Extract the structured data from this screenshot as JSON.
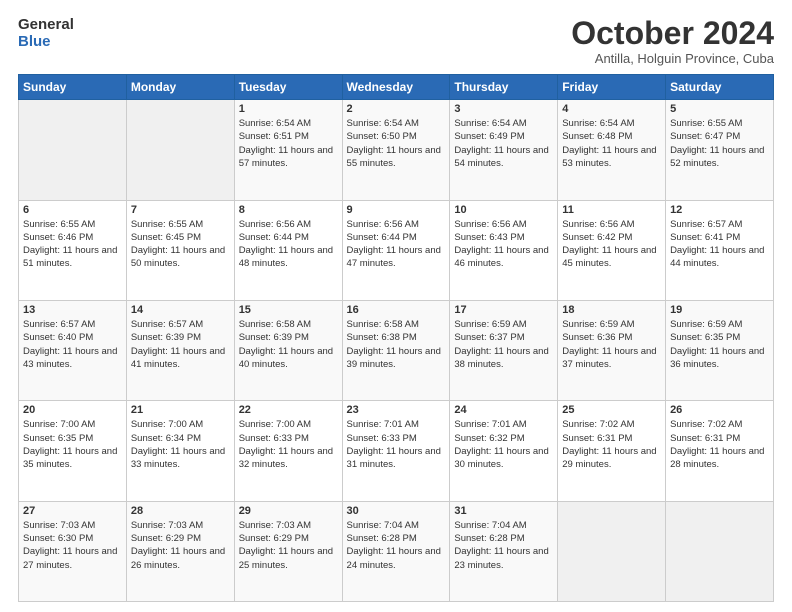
{
  "logo": {
    "line1": "General",
    "line2": "Blue"
  },
  "header": {
    "title": "October 2024",
    "subtitle": "Antilla, Holguin Province, Cuba"
  },
  "weekdays": [
    "Sunday",
    "Monday",
    "Tuesday",
    "Wednesday",
    "Thursday",
    "Friday",
    "Saturday"
  ],
  "weeks": [
    [
      {
        "day": "",
        "empty": true
      },
      {
        "day": "",
        "empty": true
      },
      {
        "day": "1",
        "sunrise": "6:54 AM",
        "sunset": "6:51 PM",
        "daylight": "11 hours and 57 minutes."
      },
      {
        "day": "2",
        "sunrise": "6:54 AM",
        "sunset": "6:50 PM",
        "daylight": "11 hours and 55 minutes."
      },
      {
        "day": "3",
        "sunrise": "6:54 AM",
        "sunset": "6:49 PM",
        "daylight": "11 hours and 54 minutes."
      },
      {
        "day": "4",
        "sunrise": "6:54 AM",
        "sunset": "6:48 PM",
        "daylight": "11 hours and 53 minutes."
      },
      {
        "day": "5",
        "sunrise": "6:55 AM",
        "sunset": "6:47 PM",
        "daylight": "11 hours and 52 minutes."
      }
    ],
    [
      {
        "day": "6",
        "sunrise": "6:55 AM",
        "sunset": "6:46 PM",
        "daylight": "11 hours and 51 minutes."
      },
      {
        "day": "7",
        "sunrise": "6:55 AM",
        "sunset": "6:45 PM",
        "daylight": "11 hours and 50 minutes."
      },
      {
        "day": "8",
        "sunrise": "6:56 AM",
        "sunset": "6:44 PM",
        "daylight": "11 hours and 48 minutes."
      },
      {
        "day": "9",
        "sunrise": "6:56 AM",
        "sunset": "6:44 PM",
        "daylight": "11 hours and 47 minutes."
      },
      {
        "day": "10",
        "sunrise": "6:56 AM",
        "sunset": "6:43 PM",
        "daylight": "11 hours and 46 minutes."
      },
      {
        "day": "11",
        "sunrise": "6:56 AM",
        "sunset": "6:42 PM",
        "daylight": "11 hours and 45 minutes."
      },
      {
        "day": "12",
        "sunrise": "6:57 AM",
        "sunset": "6:41 PM",
        "daylight": "11 hours and 44 minutes."
      }
    ],
    [
      {
        "day": "13",
        "sunrise": "6:57 AM",
        "sunset": "6:40 PM",
        "daylight": "11 hours and 43 minutes."
      },
      {
        "day": "14",
        "sunrise": "6:57 AM",
        "sunset": "6:39 PM",
        "daylight": "11 hours and 41 minutes."
      },
      {
        "day": "15",
        "sunrise": "6:58 AM",
        "sunset": "6:39 PM",
        "daylight": "11 hours and 40 minutes."
      },
      {
        "day": "16",
        "sunrise": "6:58 AM",
        "sunset": "6:38 PM",
        "daylight": "11 hours and 39 minutes."
      },
      {
        "day": "17",
        "sunrise": "6:59 AM",
        "sunset": "6:37 PM",
        "daylight": "11 hours and 38 minutes."
      },
      {
        "day": "18",
        "sunrise": "6:59 AM",
        "sunset": "6:36 PM",
        "daylight": "11 hours and 37 minutes."
      },
      {
        "day": "19",
        "sunrise": "6:59 AM",
        "sunset": "6:35 PM",
        "daylight": "11 hours and 36 minutes."
      }
    ],
    [
      {
        "day": "20",
        "sunrise": "7:00 AM",
        "sunset": "6:35 PM",
        "daylight": "11 hours and 35 minutes."
      },
      {
        "day": "21",
        "sunrise": "7:00 AM",
        "sunset": "6:34 PM",
        "daylight": "11 hours and 33 minutes."
      },
      {
        "day": "22",
        "sunrise": "7:00 AM",
        "sunset": "6:33 PM",
        "daylight": "11 hours and 32 minutes."
      },
      {
        "day": "23",
        "sunrise": "7:01 AM",
        "sunset": "6:33 PM",
        "daylight": "11 hours and 31 minutes."
      },
      {
        "day": "24",
        "sunrise": "7:01 AM",
        "sunset": "6:32 PM",
        "daylight": "11 hours and 30 minutes."
      },
      {
        "day": "25",
        "sunrise": "7:02 AM",
        "sunset": "6:31 PM",
        "daylight": "11 hours and 29 minutes."
      },
      {
        "day": "26",
        "sunrise": "7:02 AM",
        "sunset": "6:31 PM",
        "daylight": "11 hours and 28 minutes."
      }
    ],
    [
      {
        "day": "27",
        "sunrise": "7:03 AM",
        "sunset": "6:30 PM",
        "daylight": "11 hours and 27 minutes."
      },
      {
        "day": "28",
        "sunrise": "7:03 AM",
        "sunset": "6:29 PM",
        "daylight": "11 hours and 26 minutes."
      },
      {
        "day": "29",
        "sunrise": "7:03 AM",
        "sunset": "6:29 PM",
        "daylight": "11 hours and 25 minutes."
      },
      {
        "day": "30",
        "sunrise": "7:04 AM",
        "sunset": "6:28 PM",
        "daylight": "11 hours and 24 minutes."
      },
      {
        "day": "31",
        "sunrise": "7:04 AM",
        "sunset": "6:28 PM",
        "daylight": "11 hours and 23 minutes."
      },
      {
        "day": "",
        "empty": true
      },
      {
        "day": "",
        "empty": true
      }
    ]
  ],
  "labels": {
    "sunrise": "Sunrise: ",
    "sunset": "Sunset: ",
    "daylight": "Daylight: "
  }
}
